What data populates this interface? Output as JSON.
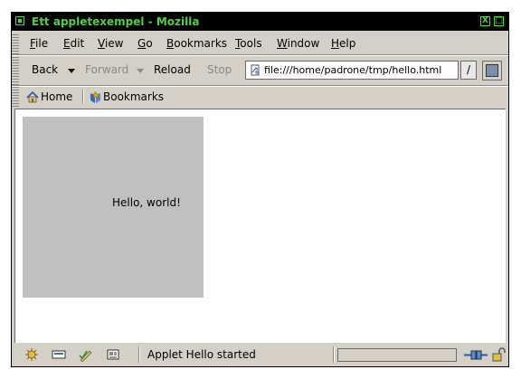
{
  "window": {
    "title": "Ett appletexempel - Mozilla",
    "title_buttons": [
      "X",
      "□"
    ]
  },
  "menu": {
    "items": [
      "File",
      "Edit",
      "View",
      "Go",
      "Bookmarks",
      "Tools",
      "Window",
      "Help"
    ]
  },
  "navigation": {
    "back_label": "Back",
    "forward_label": "Forward",
    "reload_label": "Reload",
    "stop_label": "Stop",
    "url": "file:///home/padrone/tmp/hello.html",
    "go_label": "/"
  },
  "personal_toolbar": {
    "home_label": "Home",
    "bookmarks_label": "Bookmarks"
  },
  "page": {
    "applet_text": "Hello, world!"
  },
  "status": {
    "text": "Applet Hello started",
    "progress": 0
  },
  "colors": {
    "titlebar_bg": "#000000",
    "titlebar_text": "#4fd040",
    "chrome": "#d4d0c8",
    "applet_bg": "#c0c0c0"
  },
  "icons": {
    "url_icon": "page-icon",
    "home_icon": "house-icon",
    "bookmarks_icon": "bookmark-icon",
    "status_icons": [
      "navigator-icon",
      "mail-icon",
      "composer-icon",
      "addressbook-icon"
    ],
    "online_icon": "online-plug-icon",
    "security_icon": "unlocked-padlock-icon"
  }
}
